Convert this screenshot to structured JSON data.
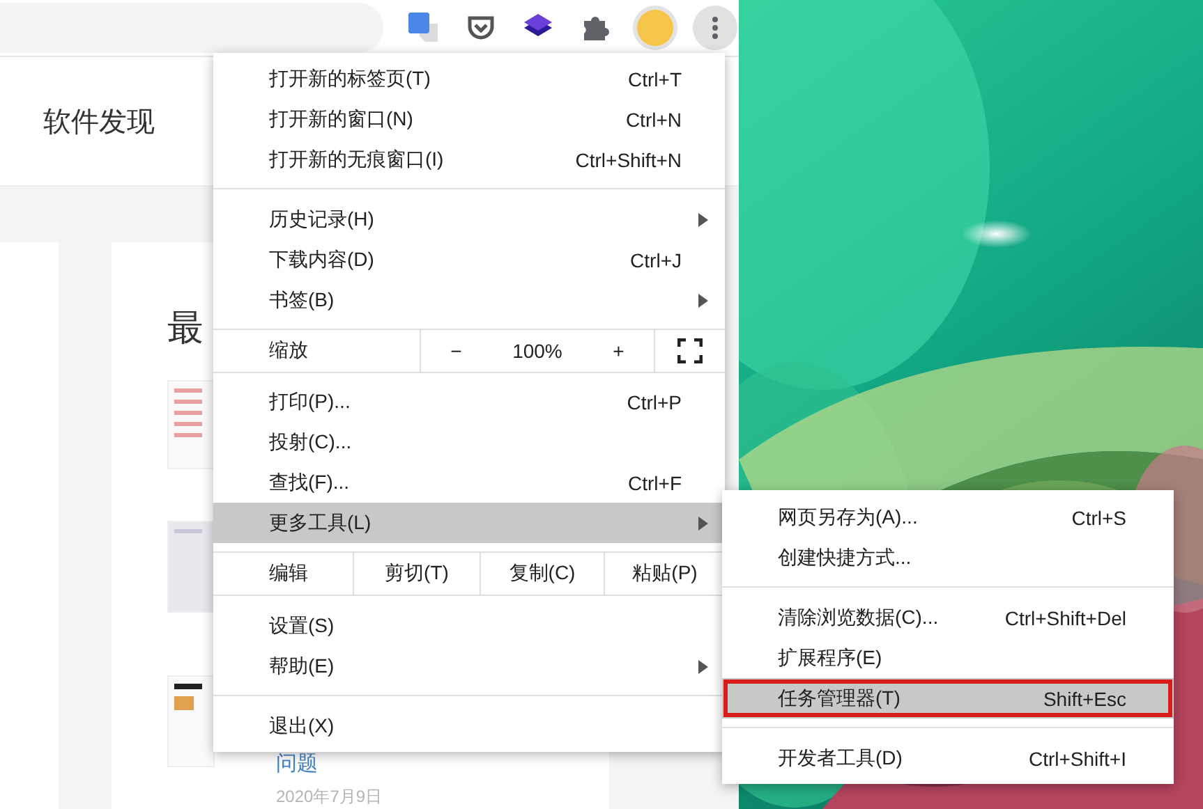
{
  "page": {
    "nav_title": "软件发现",
    "section_heading": "最",
    "article_link": "问题",
    "article_date": "2020年7月9日"
  },
  "menu": {
    "items": [
      {
        "kind": "item",
        "label": "打开新的标签页(T)",
        "shortcut": "Ctrl+T",
        "submenu": false,
        "selected": false
      },
      {
        "kind": "item",
        "label": "打开新的窗口(N)",
        "shortcut": "Ctrl+N",
        "submenu": false,
        "selected": false
      },
      {
        "kind": "item",
        "label": "打开新的无痕窗口(I)",
        "shortcut": "Ctrl+Shift+N",
        "submenu": false,
        "selected": false
      },
      {
        "kind": "separator"
      },
      {
        "kind": "item",
        "label": "历史记录(H)",
        "submenu": true,
        "selected": false
      },
      {
        "kind": "item",
        "label": "下载内容(D)",
        "shortcut": "Ctrl+J",
        "submenu": false,
        "selected": false
      },
      {
        "kind": "item",
        "label": "书签(B)",
        "submenu": true,
        "selected": false
      },
      {
        "kind": "zoom",
        "label": "缩放",
        "minus": "−",
        "value": "100%",
        "plus": "+"
      },
      {
        "kind": "item",
        "label": "打印(P)...",
        "shortcut": "Ctrl+P",
        "submenu": false,
        "selected": false
      },
      {
        "kind": "item",
        "label": "投射(C)...",
        "submenu": false,
        "selected": false
      },
      {
        "kind": "item",
        "label": "查找(F)...",
        "shortcut": "Ctrl+F",
        "submenu": false,
        "selected": false
      },
      {
        "kind": "item",
        "label": "更多工具(L)",
        "submenu": true,
        "selected": true
      },
      {
        "kind": "edit",
        "label": "编辑",
        "buttons": [
          "剪切(T)",
          "复制(C)",
          "粘贴(P)"
        ]
      },
      {
        "kind": "item",
        "label": "设置(S)",
        "submenu": false,
        "selected": false
      },
      {
        "kind": "item",
        "label": "帮助(E)",
        "submenu": true,
        "selected": false
      },
      {
        "kind": "separator"
      },
      {
        "kind": "item",
        "label": "退出(X)",
        "submenu": false,
        "selected": false
      }
    ]
  },
  "submenu": {
    "items": [
      {
        "kind": "item",
        "label": "网页另存为(A)...",
        "shortcut": "Ctrl+S",
        "selected": false,
        "annotated": false
      },
      {
        "kind": "item",
        "label": "创建快捷方式...",
        "selected": false,
        "annotated": false
      },
      {
        "kind": "separator"
      },
      {
        "kind": "item",
        "label": "清除浏览数据(C)...",
        "shortcut": "Ctrl+Shift+Del",
        "selected": false,
        "annotated": false
      },
      {
        "kind": "item",
        "label": "扩展程序(E)",
        "selected": false,
        "annotated": false
      },
      {
        "kind": "item",
        "label": "任务管理器(T)",
        "shortcut": "Shift+Esc",
        "selected": true,
        "annotated": true
      },
      {
        "kind": "separator"
      },
      {
        "kind": "item",
        "label": "开发者工具(D)",
        "shortcut": "Ctrl+Shift+I",
        "selected": false,
        "annotated": false
      }
    ]
  }
}
